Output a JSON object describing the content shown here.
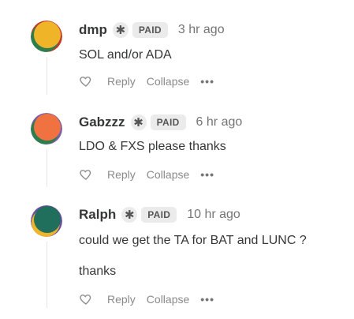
{
  "comments": [
    {
      "author": "dmp",
      "badge_icon": "asterisk-icon",
      "badge": "PAID",
      "time": "3 hr ago",
      "lines": [
        "SOL and/or ADA"
      ],
      "avatar_colors": [
        "#f0b429",
        "#2e7d4f",
        "#c0392b"
      ],
      "actions": {
        "reply": "Reply",
        "collapse": "Collapse",
        "more": "•••"
      }
    },
    {
      "author": "Gabzzz",
      "badge_icon": "asterisk-icon",
      "badge": "PAID",
      "time": "6 hr ago",
      "lines": [
        "LDO & FXS please thanks"
      ],
      "avatar_colors": [
        "#f07241",
        "#2e7d4f",
        "#7b5ea7"
      ],
      "actions": {
        "reply": "Reply",
        "collapse": "Collapse",
        "more": "•••"
      }
    },
    {
      "author": "Ralph",
      "badge_icon": "asterisk-icon",
      "badge": "PAID",
      "time": "10 hr ago",
      "lines": [
        "could we get the TA for BAT and LUNC ?",
        "thanks"
      ],
      "avatar_colors": [
        "#1f6f5c",
        "#f0b429",
        "#6a4fa3"
      ],
      "actions": {
        "reply": "Reply",
        "collapse": "Collapse",
        "more": "•••"
      }
    }
  ]
}
